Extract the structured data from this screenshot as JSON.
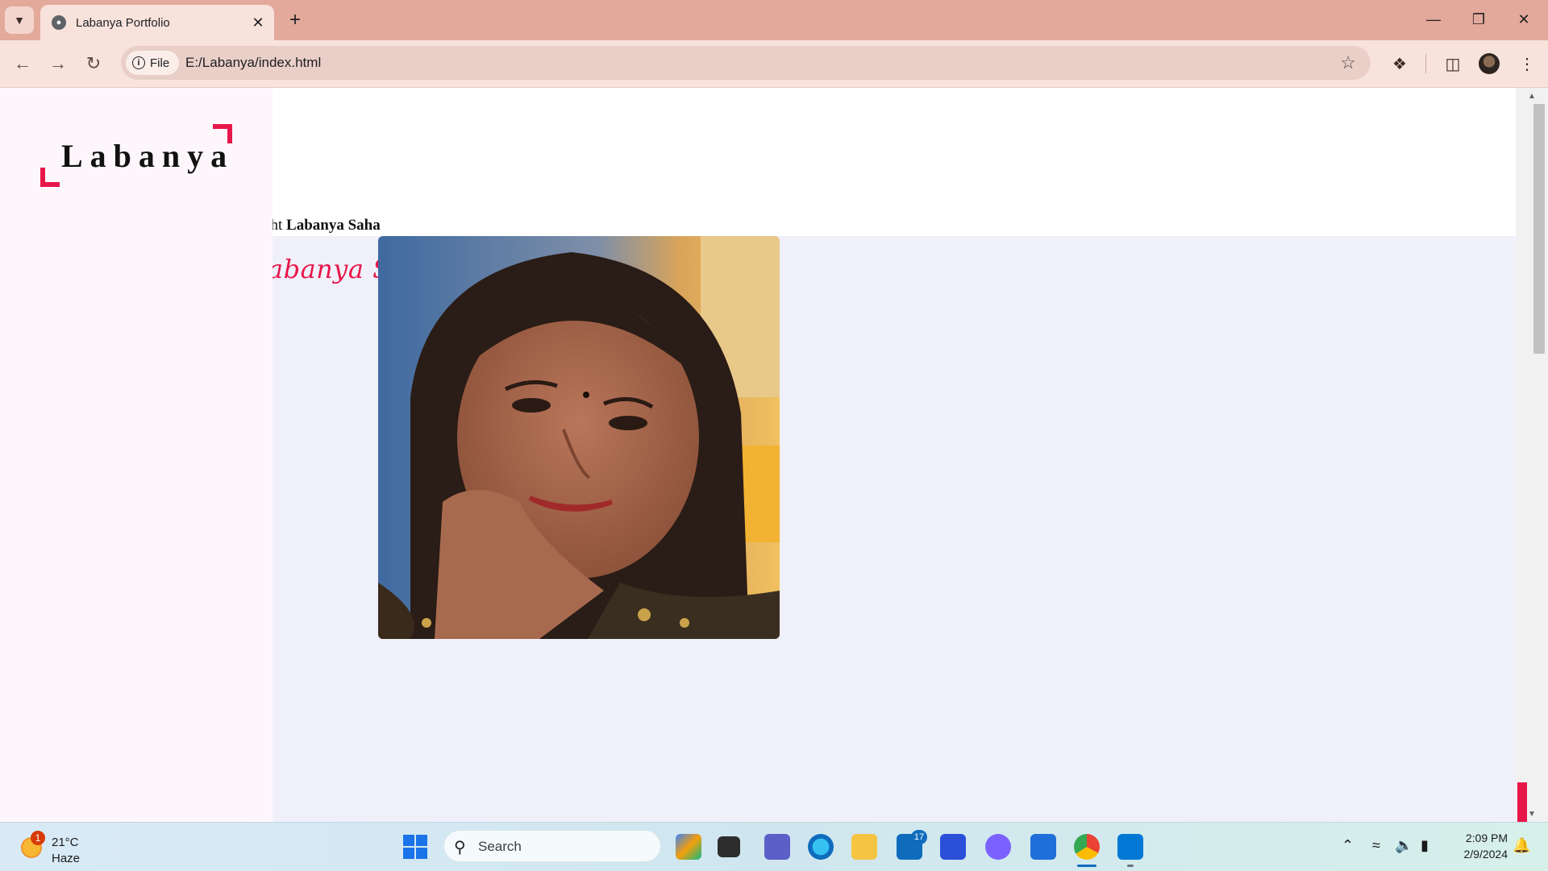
{
  "browser": {
    "tab_title": "Labanya Portfolio",
    "new_tab_label": "+",
    "site_chip_label": "File",
    "address": "E:/Labanya/index.html"
  },
  "page": {
    "logo_text": "Labanya",
    "greeting_prefix": "ght",
    "greeting_name": "Labanya Saha",
    "script_name": "abanya Saha",
    "photo_alt": "Portrait of Labanya Saha"
  },
  "taskbar": {
    "weather_badge": "1",
    "temperature": "21°C",
    "condition": "Haze",
    "search_placeholder": "Search",
    "mail_badge": "17",
    "time": "2:09 PM",
    "date": "2/9/2024"
  },
  "colors": {
    "accent": "#e8174a",
    "tabstrip": "#e3a99b",
    "toolbar": "#f8e2dc",
    "sidebar": "#fdf7fc",
    "hero_band": "#f0f0fb"
  },
  "icons": [
    "tab-search-icon",
    "globe-icon",
    "close-icon",
    "minimize-icon",
    "restore-icon",
    "back-icon",
    "forward-icon",
    "reload-icon",
    "info-icon",
    "star-icon",
    "extensions-icon",
    "side-panel-icon",
    "profile-avatar-icon",
    "windows-start-icon",
    "search-icon",
    "wifi-icon",
    "volume-icon",
    "battery-icon",
    "notification-bell-icon"
  ]
}
